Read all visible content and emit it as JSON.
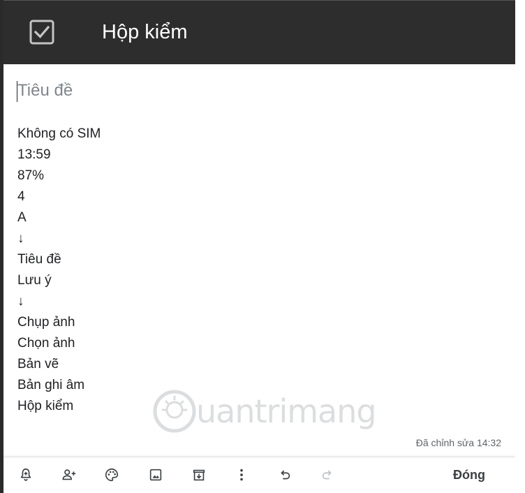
{
  "header": {
    "title": "Hộp kiểm",
    "icon": "checkbox-icon"
  },
  "note": {
    "title_placeholder": "Tiêu đề",
    "lines": [
      "Không có SIM",
      "13:59",
      "87%",
      "4",
      "A",
      "↓",
      "Tiêu đề",
      "Lưu ý",
      "↓",
      "Chụp ảnh",
      "Chọn ảnh",
      "Bản vẽ",
      "Bản ghi âm",
      "Hộp kiểm"
    ],
    "edited": "Đã chỉnh sửa 14:32"
  },
  "watermark": {
    "text": "uantrimang"
  },
  "toolbar": {
    "icons": [
      "add-reminder-icon",
      "collaborator-icon",
      "palette-icon",
      "image-icon",
      "archive-icon",
      "more-icon",
      "undo-icon",
      "redo-icon"
    ],
    "close_label": "Đóng"
  },
  "colors": {
    "header_bg": "#2d2d2d",
    "header_text": "#ffffff",
    "text": "#202124",
    "muted": "#5f6368"
  }
}
